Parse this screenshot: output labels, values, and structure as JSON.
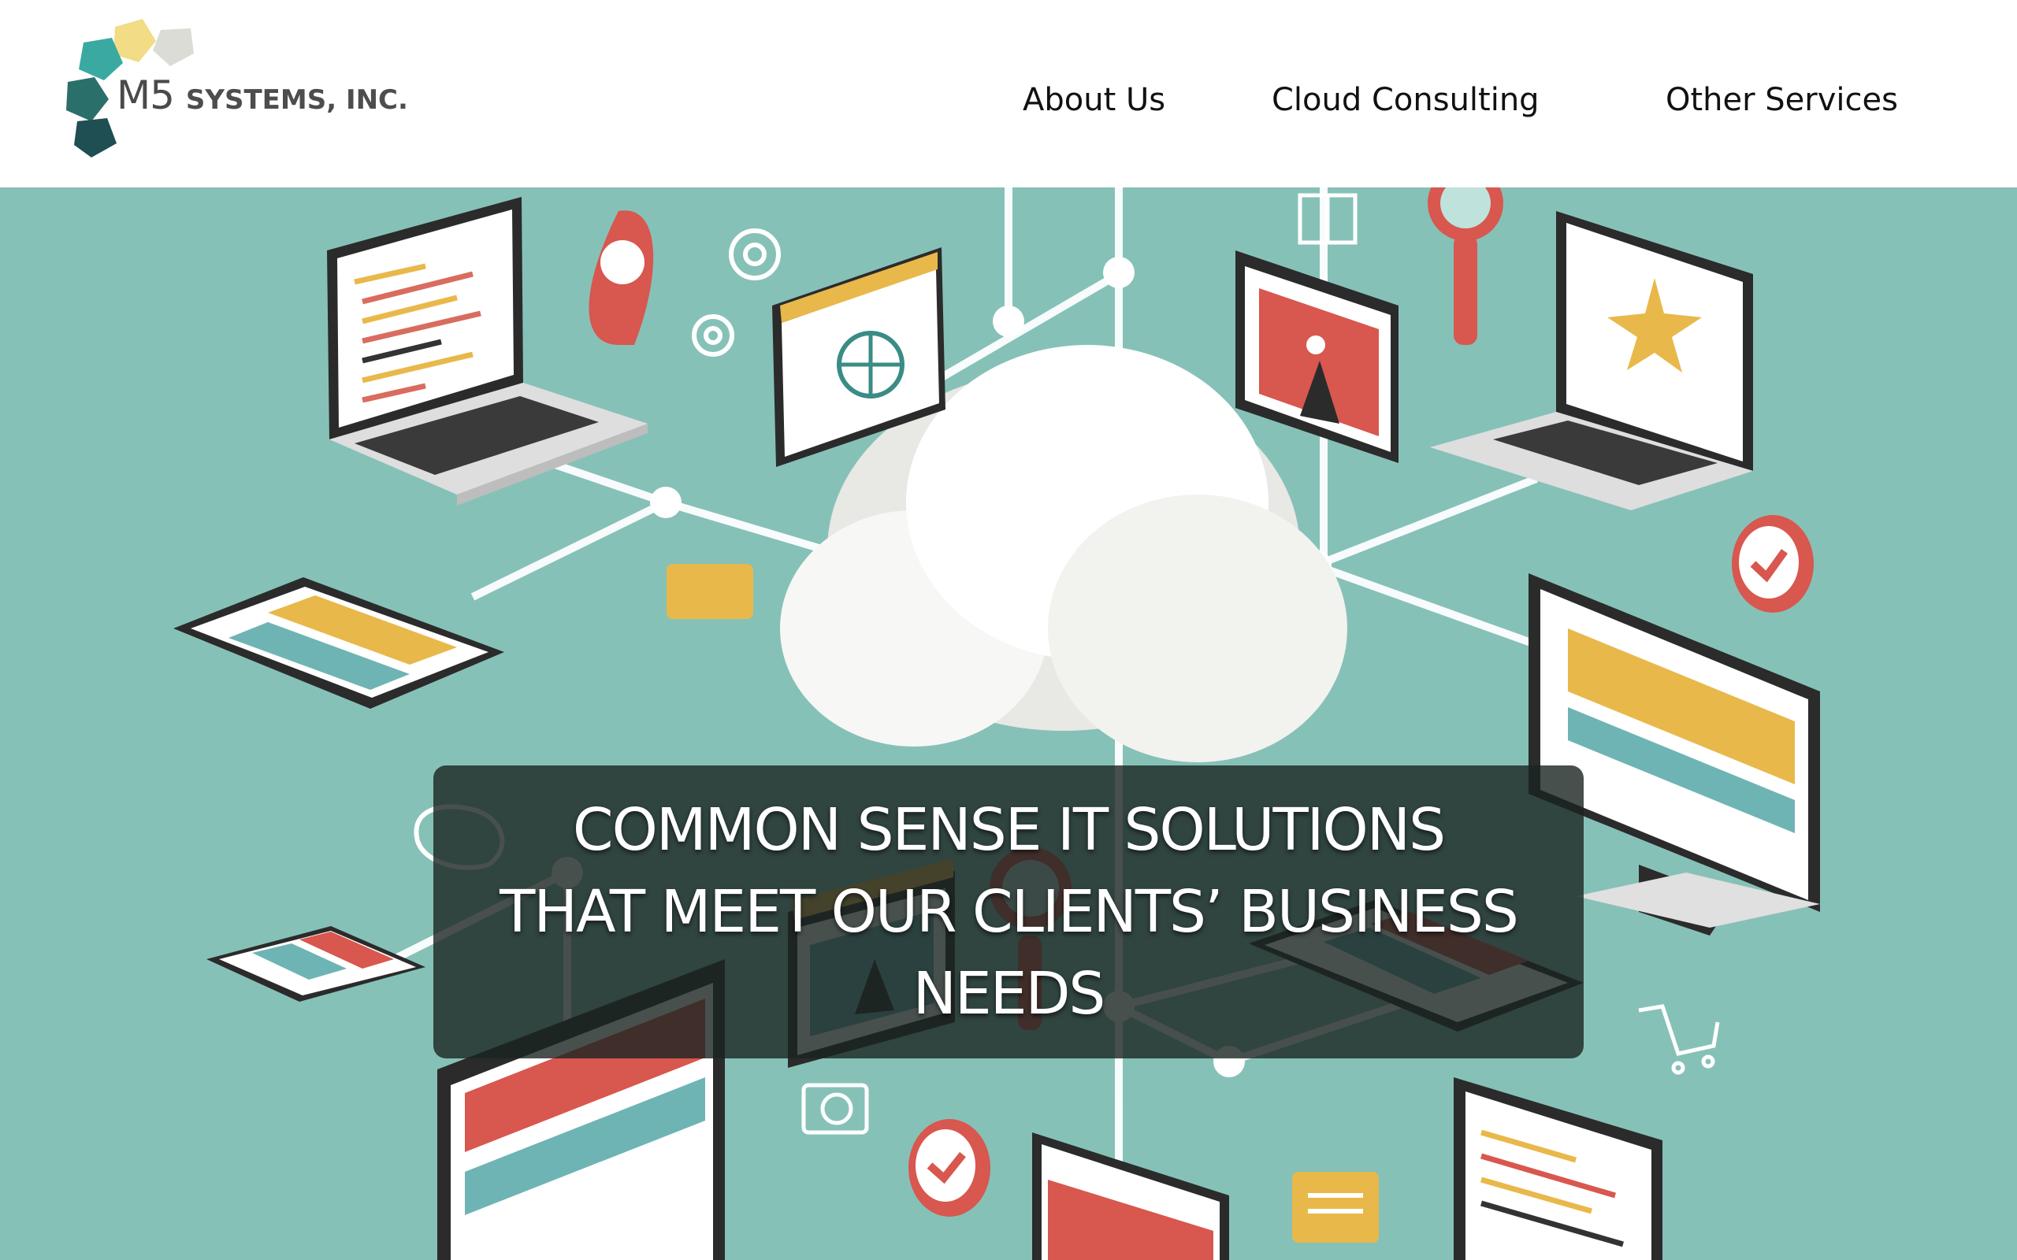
{
  "brand": {
    "logo_main": "M5",
    "logo_sub": "SYSTEMS, INC.",
    "colors": {
      "teal": "#3aa9a2",
      "yellow": "#f2dd86",
      "gray": "#dcdcd6",
      "dark_teal": "#2b6f6b",
      "darkest_teal": "#1f4e53"
    }
  },
  "nav": {
    "items": [
      {
        "label": "About Us"
      },
      {
        "label": "Cloud Consulting"
      },
      {
        "label": "Other Services"
      }
    ]
  },
  "hero": {
    "headline_lines": [
      "COMMON SENSE IT SOLUTIONS",
      "THAT MEET OUR CLIENTS’ BUSINESS",
      "NEEDS"
    ],
    "background_color": "#86c1b8"
  }
}
